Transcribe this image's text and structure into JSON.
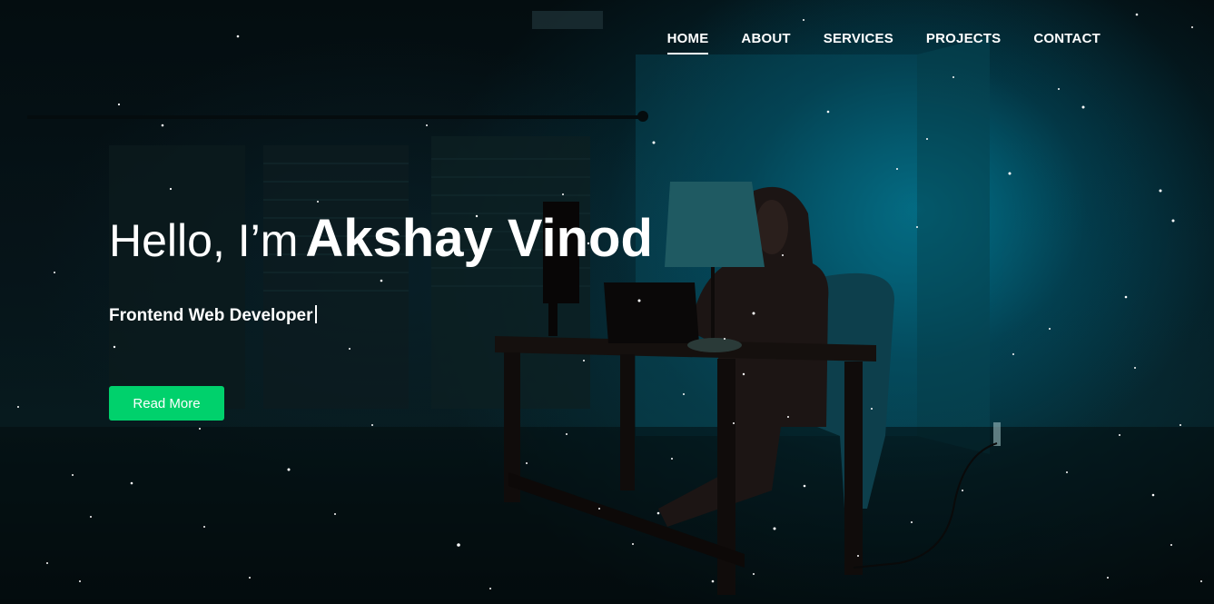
{
  "nav": {
    "items": [
      {
        "label": "HOME",
        "active": true
      },
      {
        "label": "ABOUT",
        "active": false
      },
      {
        "label": "SERVICES",
        "active": false
      },
      {
        "label": "PROJECTS",
        "active": false
      },
      {
        "label": "CONTACT",
        "active": false
      }
    ]
  },
  "hero": {
    "greeting": "Hello, I’m",
    "name": "Akshay Vinod",
    "role": "Frontend Web Developer",
    "cta_label": "Read More"
  },
  "colors": {
    "accent": "#00d16c",
    "text": "#ffffff",
    "background": "#02080a",
    "glow": "#00aacd"
  }
}
